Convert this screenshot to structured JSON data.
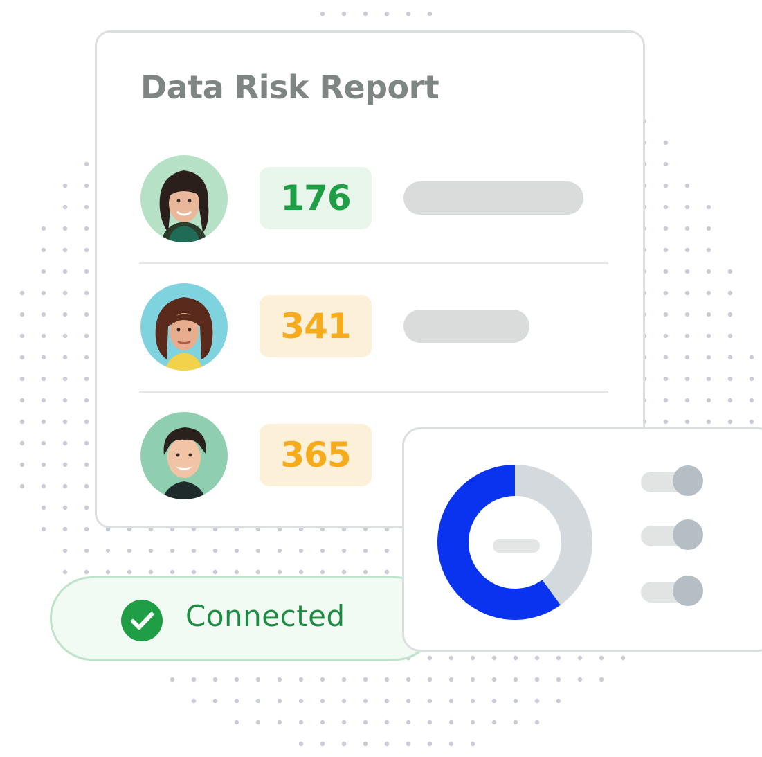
{
  "report": {
    "title": "Data Risk Report",
    "rows": [
      {
        "score": "176",
        "level": "low",
        "bar_fraction": 1.0
      },
      {
        "score": "341",
        "level": "medium",
        "bar_fraction": 0.7
      },
      {
        "score": "365",
        "level": "medium",
        "bar_fraction": 0
      }
    ]
  },
  "status": {
    "label": "Connected",
    "icon": "check-circle-icon"
  },
  "chart_data": {
    "type": "pie",
    "values": [
      60,
      40
    ],
    "colors": [
      "#0a33f0",
      "#d4d9dd"
    ]
  },
  "toggles": [
    {
      "state": "on"
    },
    {
      "state": "on"
    },
    {
      "state": "on"
    }
  ],
  "colors": {
    "low_risk": "#1f9e46",
    "medium_risk": "#f5ab1b",
    "connected": "#1e8b43",
    "donut_primary": "#0a33f0",
    "donut_secondary": "#d4d9dd"
  }
}
